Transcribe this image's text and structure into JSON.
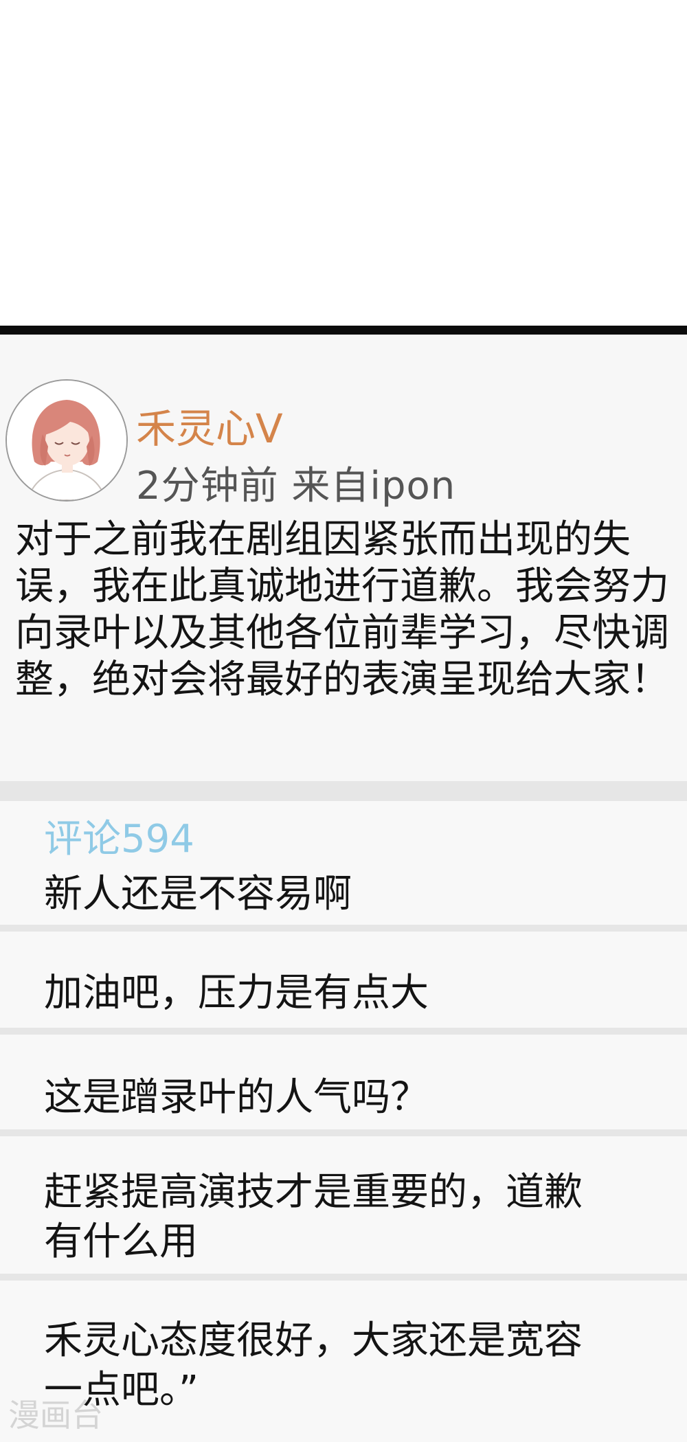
{
  "post": {
    "username": "禾灵心V",
    "meta": "2分钟前  来自ipon",
    "body": "对于之前我在剧组因紧张而出现的失误，我在此真诚地进行道歉。我会努力向录叶以及其他各位前辈学习，尽快调整，绝对会将最好的表演呈现给大家！"
  },
  "comments": {
    "header": "评论594",
    "items": [
      "新人还是不容易啊",
      "加油吧，压力是有点大",
      "这是蹭录叶的人气吗？",
      "赶紧提高演技才是重要的，道歉有什么用",
      "禾灵心态度很好，大家还是宽容一点吧。”"
    ]
  },
  "watermark": "漫画台",
  "colors": {
    "username": "#d4844a",
    "comment_header": "#8fcae6",
    "panel": "#f7f7f7",
    "gap": "#e6e6e6",
    "divider": "#0c0c0c"
  },
  "icons": {
    "avatar": "girl-avatar-illustration"
  }
}
